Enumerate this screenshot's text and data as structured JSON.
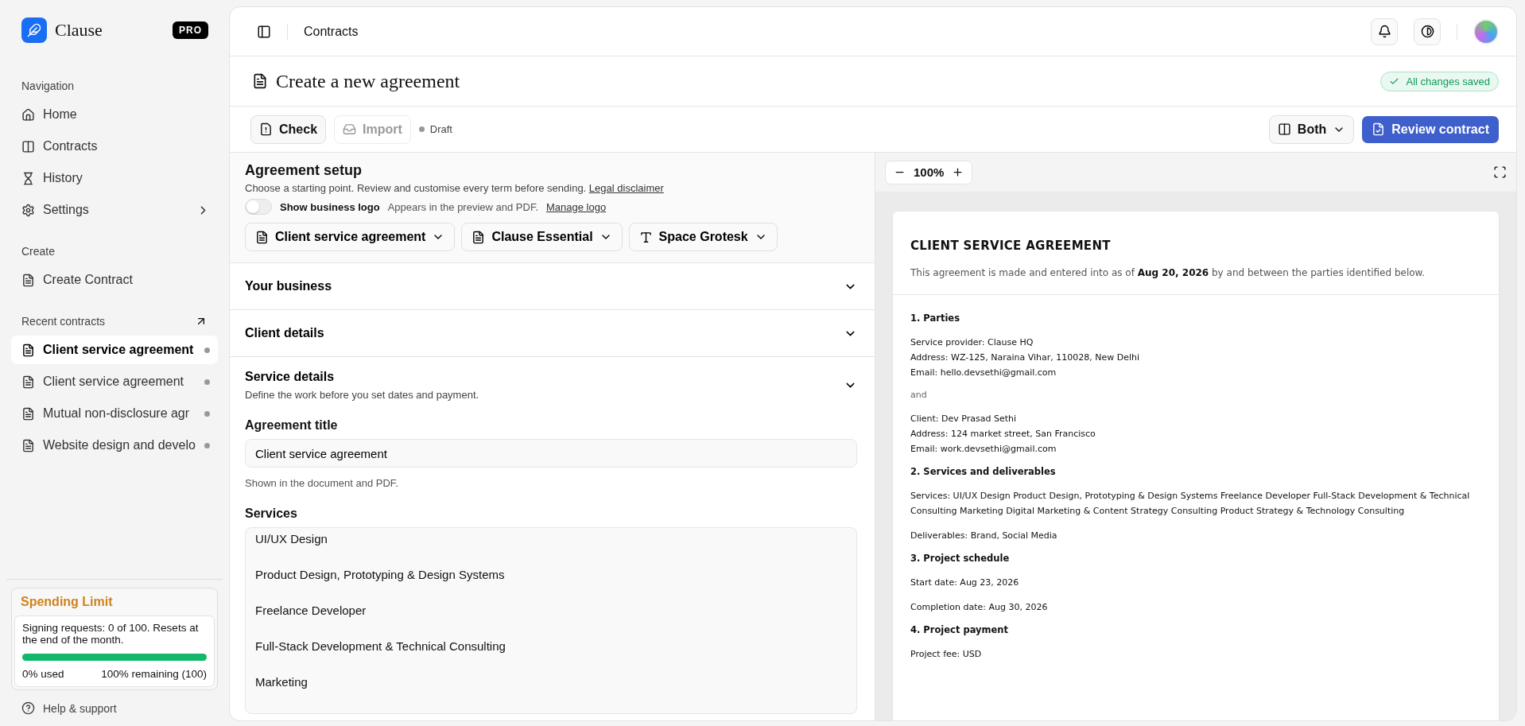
{
  "sidebar": {
    "brand": "Clause",
    "badge": "PRO",
    "sections": [
      {
        "title": "Navigation",
        "link": false,
        "items": [
          {
            "label": "Home",
            "submenu": false,
            "selected": false
          },
          {
            "label": "Contracts",
            "submenu": false,
            "selected": false
          },
          {
            "label": "History",
            "submenu": false,
            "selected": false
          },
          {
            "label": "Settings",
            "submenu": true,
            "selected": false
          }
        ]
      },
      {
        "title": "Create",
        "link": false,
        "items": [
          {
            "label": "Create Contract",
            "submenu": false,
            "selected": false
          }
        ]
      },
      {
        "title": "Recent contracts",
        "link": true,
        "items": [
          {
            "label": "Client service agreement",
            "submenu": false,
            "selected": true
          },
          {
            "label": "Client service agreement",
            "submenu": false,
            "selected": false
          },
          {
            "label": "Mutual non-disclosure agr",
            "submenu": false,
            "selected": false
          },
          {
            "label": "Website design and develo",
            "submenu": false,
            "selected": false
          }
        ]
      }
    ],
    "spending": {
      "title": "Spending Limit",
      "text": "Signing requests: 0 of 100. Resets at the end of the month.",
      "level": 1,
      "used": "0% used",
      "remaining": "100% remaining (100)"
    },
    "help": "Help & support"
  },
  "topbar": {
    "breadcrumb": "Contracts"
  },
  "page": {
    "title": "Create a new agreement",
    "status": "All changes saved"
  },
  "toolbar": {
    "check": "Check",
    "import": {
      "label": "Import",
      "disabled": true
    },
    "state": "Draft",
    "view": "Both",
    "review": "Review contract"
  },
  "setup": {
    "title": "Agreement setup",
    "description": "Choose a starting point. Review and customise every term before sending.",
    "disclaimer": "Legal disclaimer",
    "logo": {
      "label": "Show business logo",
      "on": false,
      "hint": "Appears in the preview and PDF.",
      "manage": "Manage logo"
    },
    "selects": [
      {
        "kind": "doc",
        "label": "Client service agreement"
      },
      {
        "kind": "doc",
        "label": "Clause Essential"
      },
      {
        "kind": "font",
        "label": "Space Grotesk"
      }
    ]
  },
  "sections": [
    {
      "title": "Your business",
      "expanded": false
    },
    {
      "title": "Client details",
      "expanded": false
    },
    {
      "title": "Service details",
      "expanded": true,
      "description": "Define the work before you set dates and payment.",
      "title_field": {
        "label": "Agreement title",
        "value": "Client service agreement",
        "help": "Shown in the document and PDF."
      },
      "services": {
        "label": "Services",
        "items": [
          "UI/UX Design",
          "Product Design, Prototyping & Design Systems",
          "Freelance Developer",
          "Full-Stack Development & Technical Consulting",
          "Marketing"
        ]
      }
    }
  ],
  "preview": {
    "zoom": "100%",
    "heading": "CLIENT SERVICE AGREEMENT",
    "intro": "This agreement is made and entered into as of **Aug 20, 2026** by and between the parties identified below.",
    "blocks": [
      {
        "kind": "heading",
        "text": "1. Parties"
      },
      {
        "kind": "lines",
        "lines": [
          "Service provider: Clause HQ",
          "Address: WZ-125, Naraina Vihar, 110028, New Delhi",
          "Email: hello.devsethi@gmail.com"
        ]
      },
      {
        "kind": "muted",
        "text": "and"
      },
      {
        "kind": "lines",
        "lines": [
          "Client: Dev Prasad Sethi",
          "Address: 124 market street, San Francisco",
          "Email: work.devsethi@gmail.com"
        ]
      },
      {
        "kind": "heading",
        "text": "2. Services and deliverables"
      },
      {
        "kind": "paragraph",
        "text": "Services: UI/UX Design Product Design, Prototyping & Design Systems Freelance Developer Full-Stack Development & Technical Consulting Marketing Digital Marketing & Content Strategy Consulting Product Strategy & Technology Consulting"
      },
      {
        "kind": "paragraph",
        "text": "Deliverables: Brand, Social Media"
      },
      {
        "kind": "heading",
        "text": "3. Project schedule"
      },
      {
        "kind": "paragraph",
        "text": "Start date: Aug 23, 2026"
      },
      {
        "kind": "paragraph",
        "text": "Completion date: Aug 30, 2026"
      },
      {
        "kind": "heading",
        "text": "4. Project payment"
      },
      {
        "kind": "paragraph",
        "text": "Project fee: USD"
      }
    ]
  }
}
